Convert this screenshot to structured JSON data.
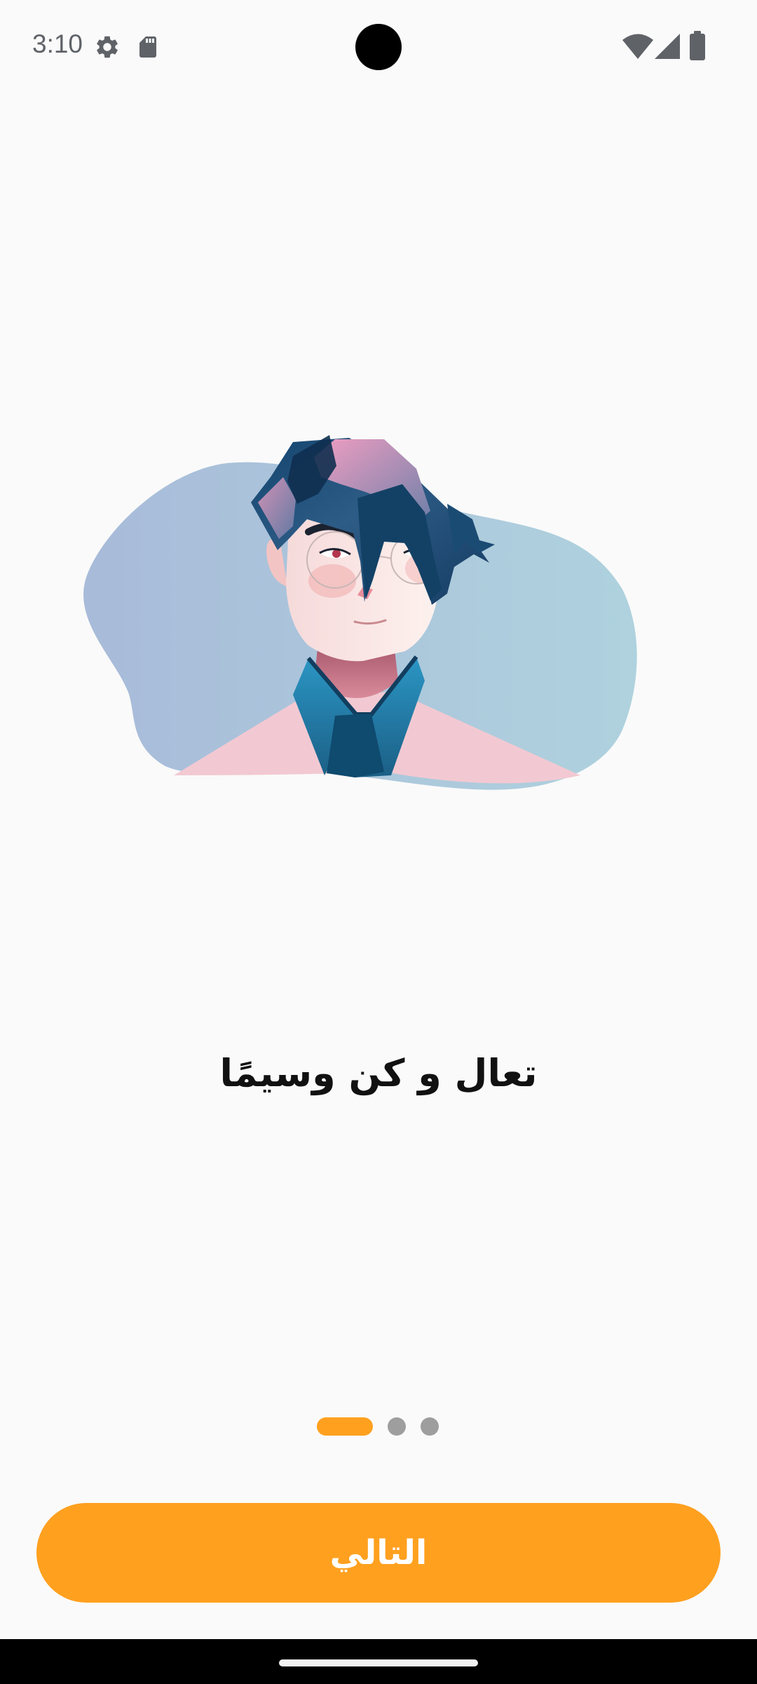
{
  "status_bar": {
    "time": "3:10",
    "left_icons": [
      "gear-icon",
      "sd-card-icon"
    ],
    "right_icons": [
      "wifi-icon",
      "cellular-signal-icon",
      "battery-icon"
    ]
  },
  "onboarding": {
    "illustration": "illustration of a man with dark blue and pink hair",
    "headline": "تعال و كن وسيمًا",
    "pager": {
      "total_pages": 3,
      "active_page": 1,
      "active_color": "#ffa01f",
      "inactive_color": "#9e9e9e"
    },
    "next_button_label": "التالي"
  },
  "colors": {
    "accent": "#ffa01f",
    "background": "#fafafa",
    "nav_bar": "#000000"
  }
}
